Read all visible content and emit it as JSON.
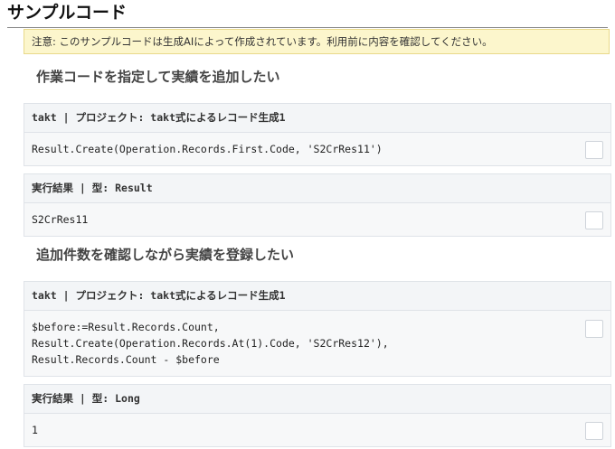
{
  "page": {
    "title": "サンプルコード"
  },
  "notice": {
    "text": "注意: このサンプルコードは生成AIによって作成されています。利用前に内容を確認してください。"
  },
  "sections": [
    {
      "heading": "作業コードを指定して実績を追加したい",
      "code_header": "takt | プロジェクト: takt式によるレコード生成1",
      "code_lines": [
        "Result.Create(Operation.Records.First.Code, 'S2CrRes11')"
      ],
      "result_header": "実行結果 | 型: Result",
      "result_value": "S2CrRes11"
    },
    {
      "heading": "追加件数を確認しながら実績を登録したい",
      "code_header": "takt | プロジェクト: takt式によるレコード生成1",
      "code_lines": [
        "$before:=Result.Records.Count,",
        "Result.Create(Operation.Records.At(1).Code, 'S2CrRes12'),",
        "Result.Records.Count - $before"
      ],
      "result_header": "実行結果 | 型: Long",
      "result_value": "1"
    }
  ]
}
